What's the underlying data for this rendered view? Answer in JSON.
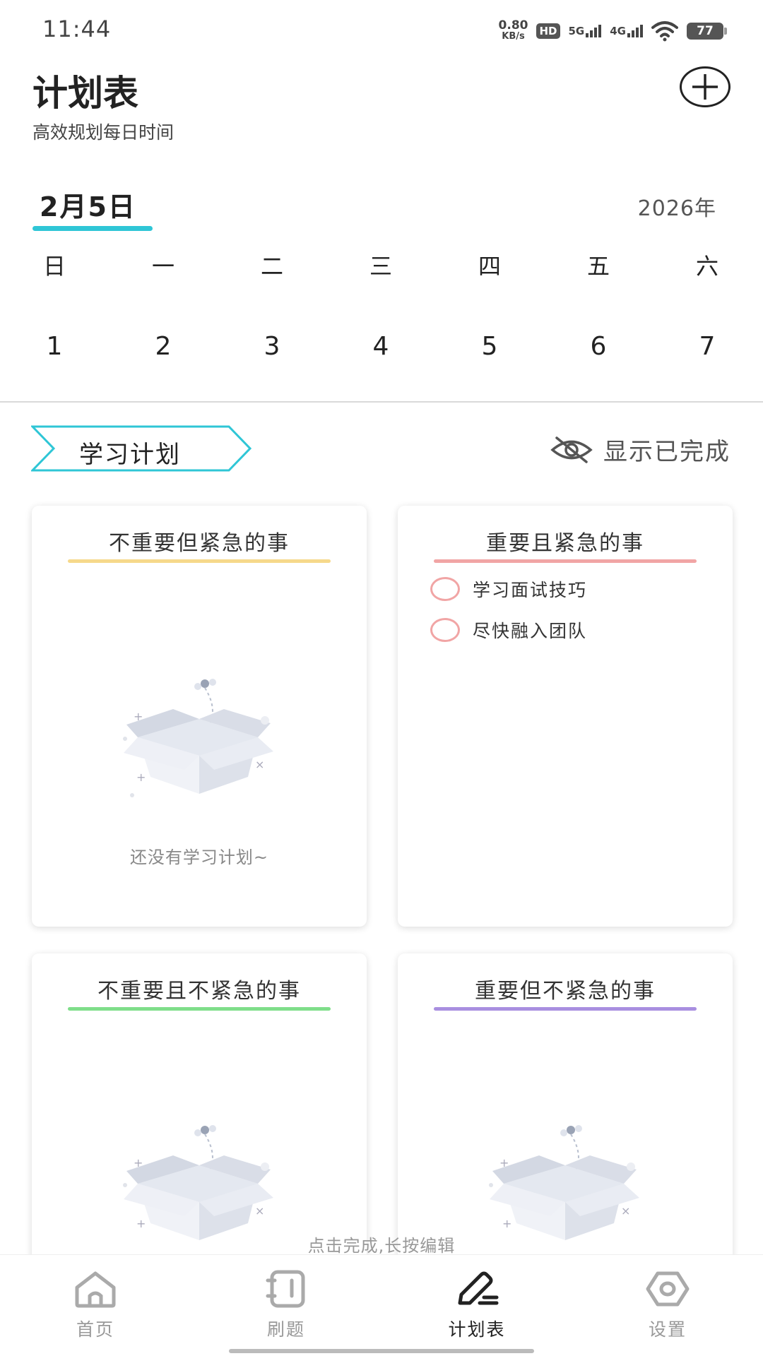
{
  "status_bar": {
    "time": "11:44",
    "net_speed_value": "0.80",
    "net_speed_unit": "KB/s",
    "hd_badge": "HD",
    "sim1_label": "5G",
    "sim2_label": "4G",
    "battery": "77",
    "icons": [
      "hd-icon",
      "signal-5g-icon",
      "signal-4g-icon",
      "wifi-icon",
      "battery-icon"
    ]
  },
  "header": {
    "title": "计划表",
    "subtitle": "高效规划每日时间",
    "add_icon": "plus-circle-icon"
  },
  "date": {
    "current_date": "2月5日",
    "year": "2026年",
    "accent_color": "#2fc6d6"
  },
  "week": {
    "day_names": [
      "日",
      "一",
      "二",
      "三",
      "四",
      "五",
      "六"
    ],
    "day_numbers": [
      "1",
      "2",
      "3",
      "4",
      "5",
      "6",
      "7"
    ]
  },
  "plan": {
    "category": "学习计划",
    "show_completed_label": "显示已完成",
    "show_completed_icon": "eye-off-icon"
  },
  "quadrants": [
    {
      "title": "不重要但紧急的事",
      "line_color": "#f6d98b",
      "empty_text": "还没有学习计划~",
      "tasks": []
    },
    {
      "title": "重要且紧急的事",
      "line_color": "#f1a5a5",
      "tasks": [
        "学习面试技巧",
        "尽快融入团队"
      ]
    },
    {
      "title": "不重要且不紧急的事",
      "line_color": "#7fde8a",
      "tasks": []
    },
    {
      "title": "重要但不紧急的事",
      "line_color": "#a98fe0",
      "tasks": []
    }
  ],
  "hint": "点击完成,长按编辑",
  "bottom_nav": [
    {
      "label": "首页",
      "icon": "home-icon",
      "active": false
    },
    {
      "label": "刷题",
      "icon": "notebook-icon",
      "active": false
    },
    {
      "label": "计划表",
      "icon": "pencil-icon",
      "active": true
    },
    {
      "label": "设置",
      "icon": "settings-icon",
      "active": false
    }
  ]
}
